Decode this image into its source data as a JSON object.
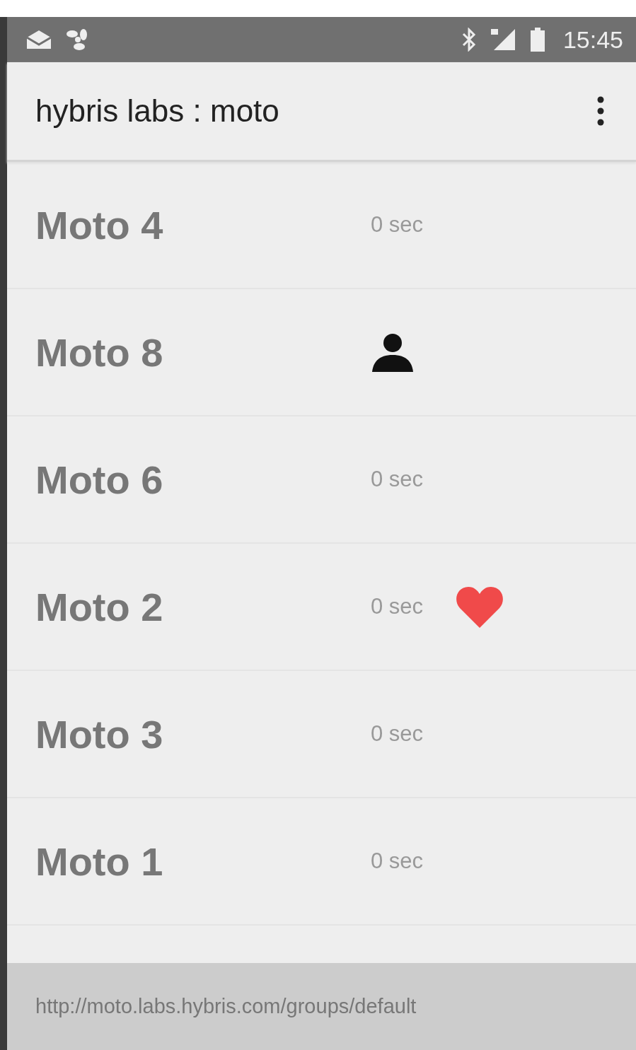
{
  "status_bar": {
    "time": "15:45"
  },
  "app_bar": {
    "title": "hybris labs : moto"
  },
  "rows": [
    {
      "name": "Moto 4",
      "kind": "time",
      "time": "0 sec",
      "favorite": false
    },
    {
      "name": "Moto 8",
      "kind": "user",
      "favorite": false
    },
    {
      "name": "Moto 6",
      "kind": "time",
      "time": "0 sec",
      "favorite": false
    },
    {
      "name": "Moto 2",
      "kind": "time",
      "time": "0 sec",
      "favorite": true
    },
    {
      "name": "Moto 3",
      "kind": "time",
      "time": "0 sec",
      "favorite": false
    },
    {
      "name": "Moto 1",
      "kind": "time",
      "time": "0 sec",
      "favorite": false
    }
  ],
  "footer": {
    "url": "http://moto.labs.hybris.com/groups/default"
  }
}
